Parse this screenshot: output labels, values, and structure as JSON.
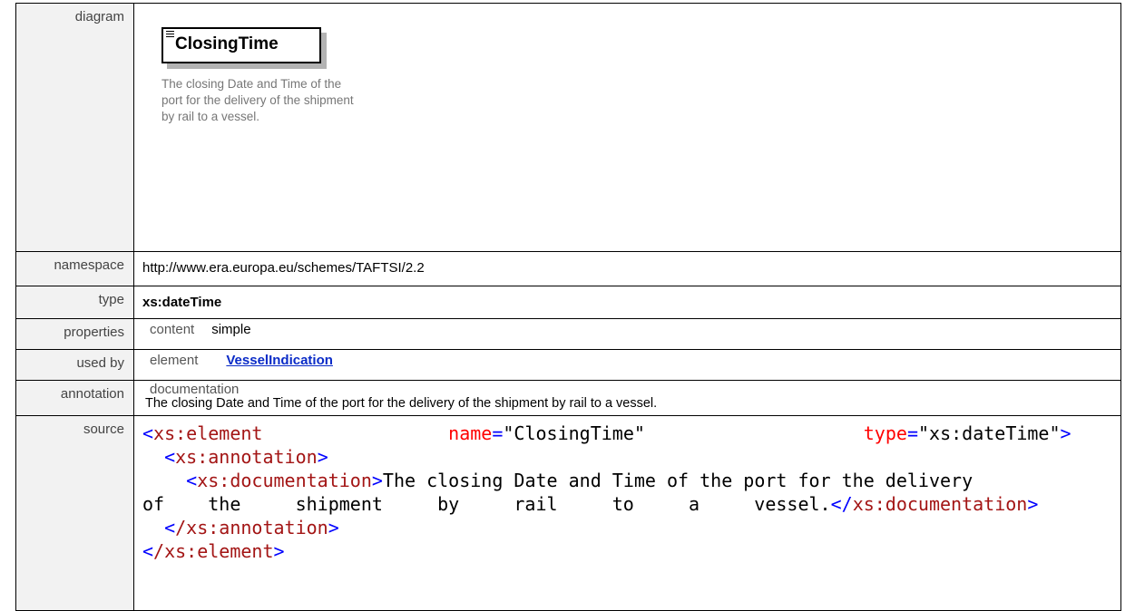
{
  "doc_row_labels": {
    "diagram": "diagram",
    "namespace": "namespace",
    "type": "type",
    "properties": "properties",
    "used_by": "used by",
    "annotation": "annotation",
    "source": "source"
  },
  "diagram": {
    "element_name": "ClosingTime",
    "documentation": "The closing Date and Time of the port for the delivery of the shipment by rail to a vessel."
  },
  "namespace": "http://www.era.europa.eu/schemes/TAFTSI/2.2",
  "type": "xs:dateTime",
  "properties": {
    "key": "content",
    "value": "simple"
  },
  "used_by": {
    "key": "element",
    "value": "VesselIndication"
  },
  "annotation": {
    "key": "documentation",
    "value": "The closing Date and Time of the port for the delivery of the shipment by rail to a vessel."
  },
  "source": {
    "open_tag": "xs:element",
    "name_attr": "name",
    "name_value": "\"ClosingTime\"",
    "type_attr": "type",
    "type_value": "\"xs:dateTime\"",
    "annotation_tag": "xs:annotation",
    "documentation_tag": "xs:documentation",
    "doc_line1": "The closing Date and Time of the port for the delivery",
    "doc_line2": "of    the     shipment     by     rail     to     a     vessel.",
    "close_annotation_tag": "/xs:annotation",
    "close_element_tag": "/xs:element"
  }
}
